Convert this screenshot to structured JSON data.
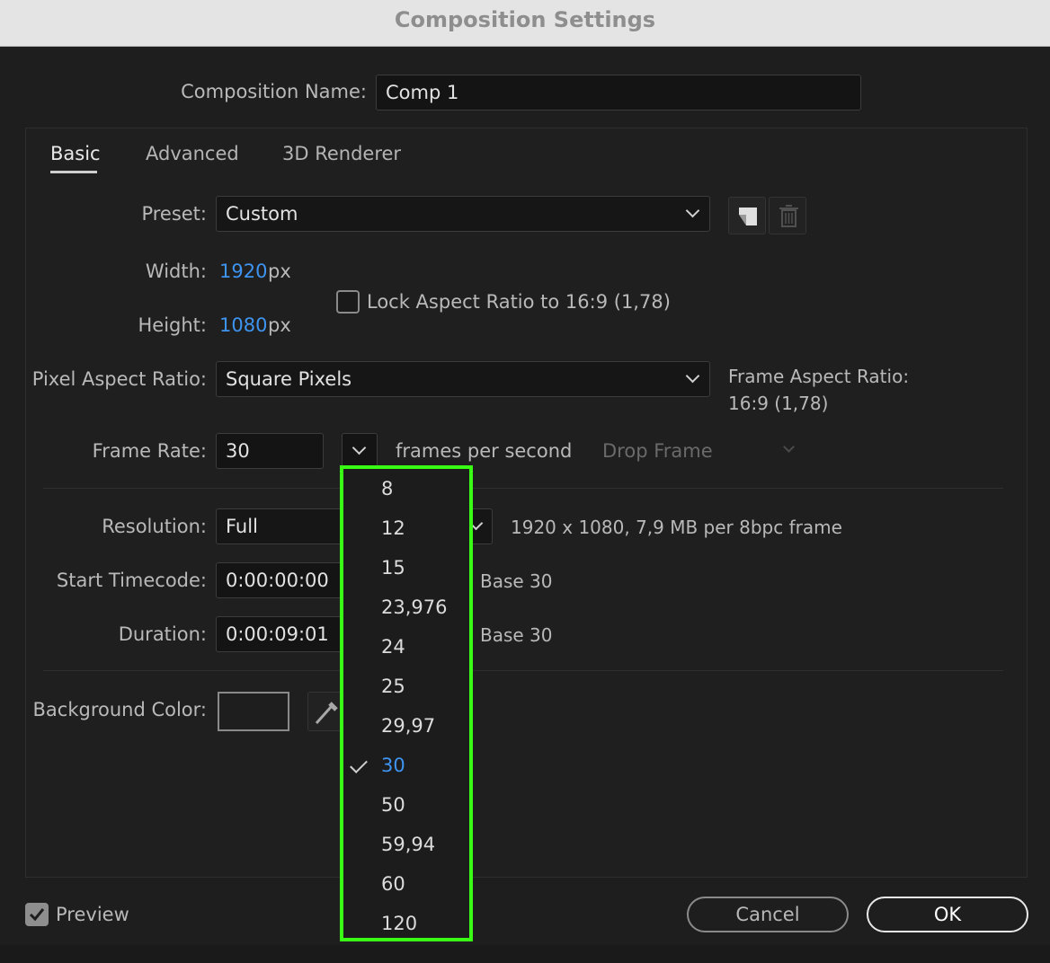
{
  "window": {
    "title": "Composition Settings"
  },
  "composition_name": {
    "label": "Composition Name:",
    "value": "Comp 1"
  },
  "tabs": [
    {
      "label": "Basic",
      "active": true
    },
    {
      "label": "Advanced",
      "active": false
    },
    {
      "label": "3D Renderer",
      "active": false
    }
  ],
  "preset": {
    "label": "Preset:",
    "value": "Custom"
  },
  "width": {
    "label": "Width:",
    "value": "1920",
    "unit": "px"
  },
  "height": {
    "label": "Height:",
    "value": "1080",
    "unit": "px"
  },
  "lock_aspect": {
    "label": "Lock Aspect Ratio to 16:9 (1,78)",
    "checked": false
  },
  "pixel_aspect": {
    "label": "Pixel Aspect Ratio:",
    "value": "Square Pixels"
  },
  "frame_aspect": {
    "label": "Frame Aspect Ratio:",
    "value": "16:9 (1,78)"
  },
  "frame_rate": {
    "label": "Frame Rate:",
    "value": "30",
    "unit": "frames per second",
    "drop_frame": "Drop Frame"
  },
  "resolution": {
    "label": "Resolution:",
    "value": "Full",
    "info": "1920 x 1080, 7,9 MB per 8bpc frame"
  },
  "start_timecode": {
    "label": "Start Timecode:",
    "value": "0:00:00:00",
    "base": "Base 30"
  },
  "duration": {
    "label": "Duration:",
    "value": "0:00:09:01",
    "base": "Base 30"
  },
  "background_color": {
    "label": "Background Color:"
  },
  "preview": {
    "label": "Preview",
    "checked": true
  },
  "buttons": {
    "cancel": "Cancel",
    "ok": "OK"
  },
  "frame_rate_menu": {
    "options": [
      "8",
      "12",
      "15",
      "23,976",
      "24",
      "25",
      "29,97",
      "30",
      "50",
      "59,94",
      "60",
      "120"
    ],
    "selected": "30"
  },
  "colors": {
    "accent": "#3e94f0",
    "highlight": "#39ff14"
  }
}
